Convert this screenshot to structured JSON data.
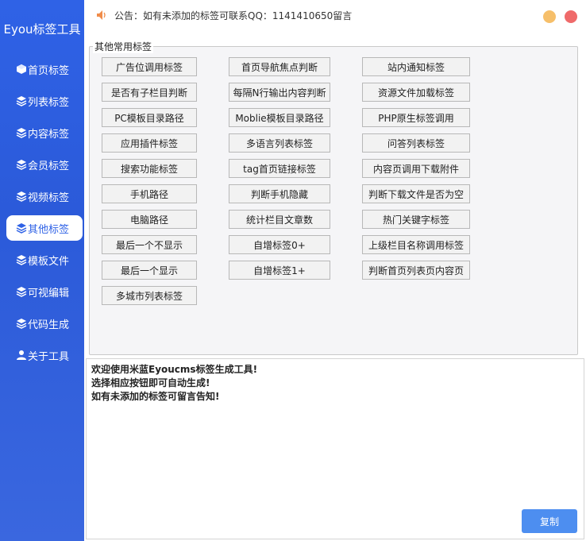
{
  "app": {
    "title": "Eyou标签工具"
  },
  "sidebar": {
    "items": [
      {
        "label": "首页标签",
        "icon": "cube-icon"
      },
      {
        "label": "列表标签",
        "icon": "layers-icon"
      },
      {
        "label": "内容标签",
        "icon": "layers-icon"
      },
      {
        "label": "会员标签",
        "icon": "layers-icon"
      },
      {
        "label": "视频标签",
        "icon": "layers-icon"
      },
      {
        "label": "其他标签",
        "icon": "layers-icon",
        "active": true
      },
      {
        "label": "模板文件",
        "icon": "layers-icon"
      },
      {
        "label": "可视编辑",
        "icon": "layers-icon"
      },
      {
        "label": "代码生成",
        "icon": "layers-icon"
      },
      {
        "label": "关于工具",
        "icon": "user-icon"
      }
    ]
  },
  "header": {
    "notice": "公告：如有未添加的标签可联系QQ：1141410650留言",
    "speaker_icon": "speaker-icon"
  },
  "group": {
    "legend": "其他常用标签",
    "buttons": [
      [
        "广告位调用标签",
        "首页导航焦点判断",
        "站内通知标签"
      ],
      [
        "是否有子栏目判断",
        "每隔N行输出内容判断",
        "资源文件加载标签"
      ],
      [
        "PC模板目录路径",
        "Moblie模板目录路径",
        "PHP原生标签调用"
      ],
      [
        "应用插件标签",
        "多语言列表标签",
        "问答列表标签"
      ],
      [
        "搜索功能标签",
        "tag首页链接标签",
        "内容页调用下载附件"
      ],
      [
        "手机路径",
        "判断手机隐藏",
        "判断下载文件是否为空"
      ],
      [
        "电脑路径",
        "统计栏目文章数",
        "热门关键字标签"
      ],
      [
        "最后一个不显示",
        "自增标签0+",
        "上级栏目名称调用标签"
      ],
      [
        "最后一个显示",
        "自增标签1+",
        "判断首页列表页内容页"
      ],
      [
        "多城市列表标签"
      ]
    ]
  },
  "output": {
    "lines": [
      "欢迎使用米蓝Eyoucms标签生成工具!",
      "选择相应按钮即可自动生成!",
      "如有未添加的标签可留言告知!"
    ]
  },
  "actions": {
    "copy_label": "复制"
  },
  "colors": {
    "sidebar": "#2f62e6",
    "minimize": "#f6bf6a",
    "close": "#ef6a6a",
    "copy_button": "#4d8ef0"
  }
}
